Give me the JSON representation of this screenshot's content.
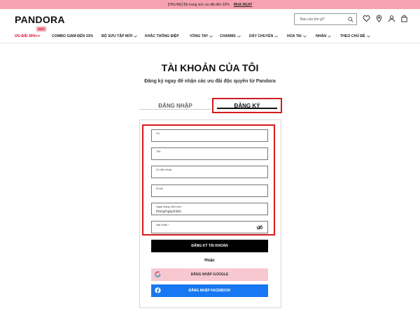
{
  "promo": {
    "text": "[ONLINE] Bộ trang sức ưu đãi đến 33%",
    "link": "MUA NGAY"
  },
  "header": {
    "logo": "PANDORA",
    "search_placeholder": "Bạn cần tìm gì?",
    "icons": [
      "heart-icon",
      "location-pin-icon",
      "user-icon",
      "shopping-bag-icon"
    ]
  },
  "nav": {
    "hot_badge": "HOT",
    "items": [
      {
        "label": "ƯU ĐÃI 30%++",
        "dropdown": false
      },
      {
        "label": "COMBO GIẢM ĐẾN 33%",
        "dropdown": false
      },
      {
        "label": "BỘ SƯU TẬP MỚI",
        "dropdown": true
      },
      {
        "label": "KHẮC THÔNG ĐIỆP",
        "dropdown": false
      },
      {
        "label": "VÒNG TAY",
        "dropdown": true
      },
      {
        "label": "CHARMS",
        "dropdown": true
      },
      {
        "label": "DÂY CHUYỀN",
        "dropdown": true
      },
      {
        "label": "HOA TAI",
        "dropdown": true
      },
      {
        "label": "NHẪN",
        "dropdown": true
      },
      {
        "label": "THEO CHỦ ĐỀ",
        "dropdown": true
      }
    ]
  },
  "page": {
    "title": "TÀI KHOẢN CỦA TÔI",
    "subtitle": "Đăng ký ngay để nhận các ưu đãi độc quyền từ Pandora"
  },
  "tabs": {
    "login": "ĐĂNG NHẬP",
    "register": "ĐĂNG KÝ",
    "active": "register"
  },
  "form": {
    "fields": [
      {
        "label": "Họ",
        "value": ""
      },
      {
        "label": "Tên",
        "value": ""
      },
      {
        "label": "Số điện thoại",
        "value": ""
      },
      {
        "label": "Email",
        "value": ""
      },
      {
        "label": "Ngày tháng năm sinh",
        "value": "tháng/ngày/năm"
      },
      {
        "label": "Mật Khẩu *",
        "value": ""
      }
    ],
    "submit": "ĐĂNG KÝ TÀI KHOẢN",
    "or": "Hoặc",
    "google": "ĐĂNG NHẬP GOOGLE",
    "facebook": "ĐĂNG NHẬP FACEBOOK"
  },
  "colors": {
    "promo_bar": "#f6a2b0",
    "highlight": "#d51a1a",
    "facebook": "#1877f2",
    "google_bg": "#f8c8d1",
    "sale": "#e4002b"
  }
}
